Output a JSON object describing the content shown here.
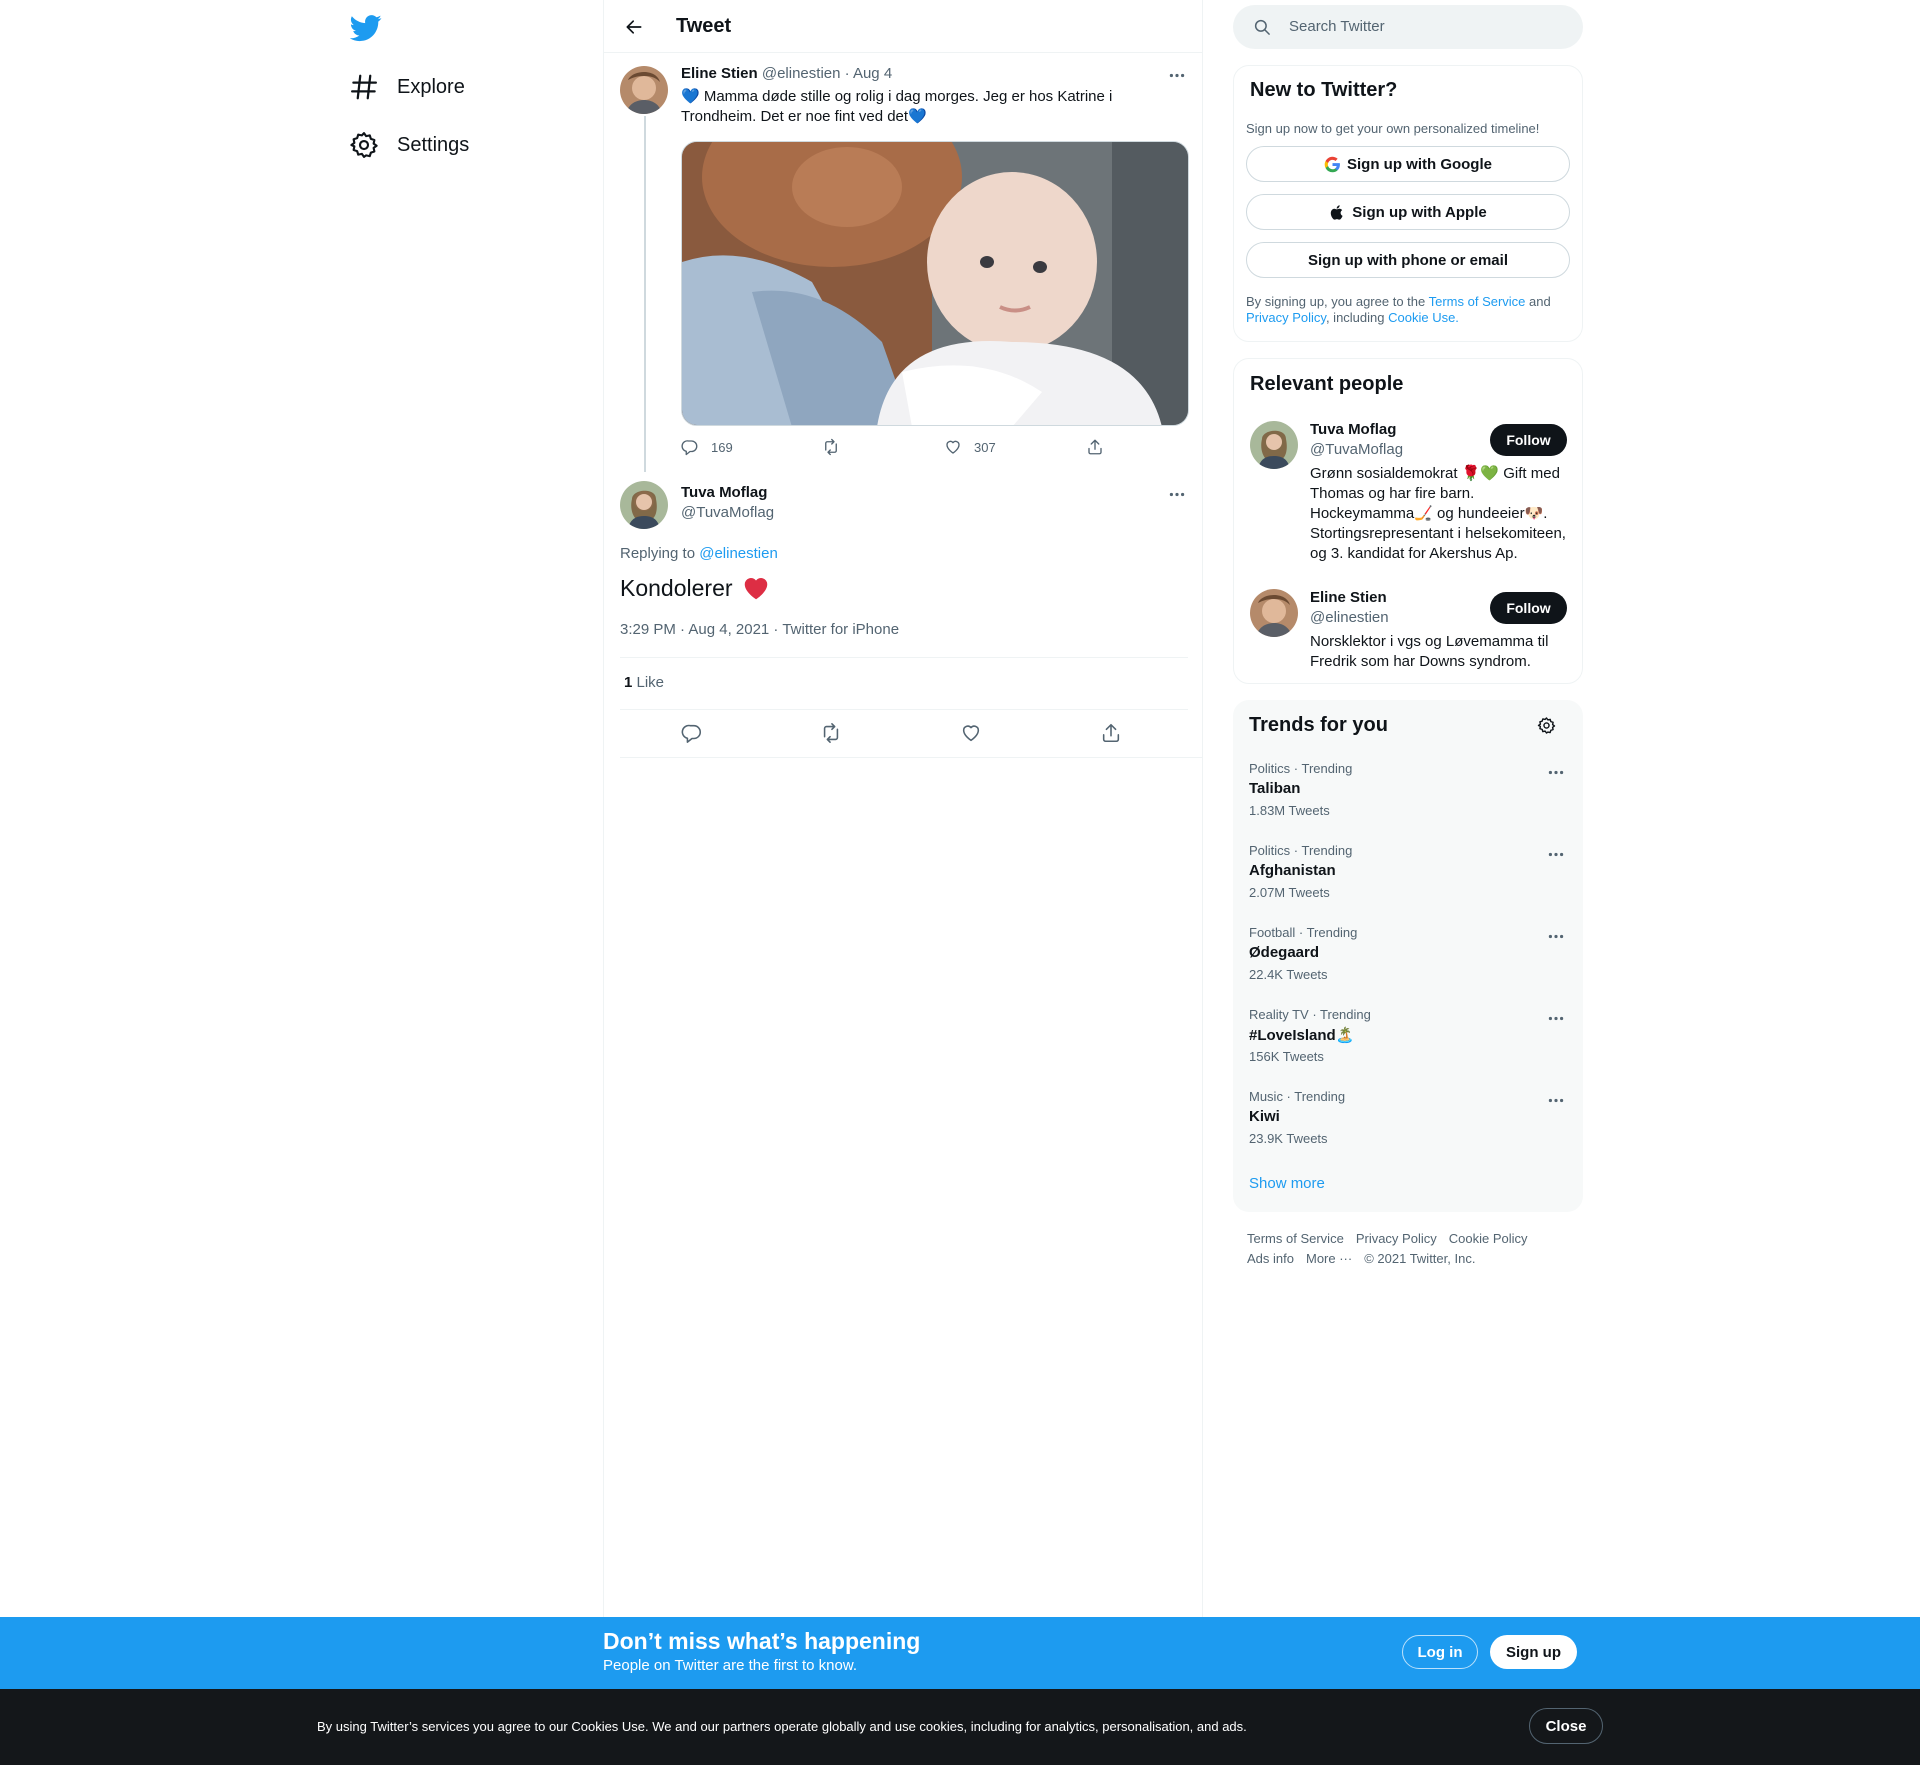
{
  "nav": {
    "logo": "twitter-bird-icon",
    "items": [
      {
        "label": "Explore",
        "icon": "hashtag-icon"
      },
      {
        "label": "Settings",
        "icon": "gear-icon"
      }
    ]
  },
  "header": {
    "title": "Tweet"
  },
  "tweet1": {
    "name": "Eline Stien",
    "meta": " @elinestien · Aug 4",
    "text": "💙 Mamma døde stille og rolig i dag morges. Jeg er hos Katrine i Trondheim. Det er noe fint ved det💙",
    "reply_count": "169",
    "retweet_count": "",
    "like_count": "307"
  },
  "tweet2": {
    "name": "Tuva Moflag",
    "handle": "@TuvaMoflag",
    "replying_prefix": "Replying to ",
    "replying_handle": "@elinestien",
    "text": "Kondolerer",
    "timestamp": "3:29 PM · Aug 4, 2021 · Twitter for iPhone",
    "like_count": "1",
    "like_label": " Like"
  },
  "search": {
    "placeholder": "Search Twitter"
  },
  "signup_card": {
    "title": "New to Twitter?",
    "subtitle": "Sign up now to get your own personalized timeline!",
    "google": "Sign up with Google",
    "apple": "Sign up with Apple",
    "phone": "Sign up with phone or email",
    "legal_1": "By signing up, you agree to the ",
    "terms": "Terms of Service",
    "legal_2": " and ",
    "privacy": "Privacy Policy",
    "legal_3": ", including ",
    "cookie": "Cookie Use."
  },
  "relevant": {
    "title": "Relevant people",
    "people": [
      {
        "name": "Tuva Moflag",
        "handle": "@TuvaMoflag",
        "follow": "Follow",
        "bio": "Grønn sosialdemokrat 🌹💚 Gift med Thomas og har fire barn. Hockeymamma🏒 og hundeeier🐶. Stortingsrepresentant i helsekomiteen, og 3. kandidat for Akershus Ap."
      },
      {
        "name": "Eline Stien",
        "handle": "@elinestien",
        "follow": "Follow",
        "bio": "Norsklektor i vgs og Løvemamma til Fredrik som har Downs syndrom."
      }
    ]
  },
  "trends": {
    "title": "Trends for you",
    "items": [
      {
        "category": "Politics · Trending",
        "name": "Taliban",
        "count": "1.83M Tweets"
      },
      {
        "category": "Politics · Trending",
        "name": "Afghanistan",
        "count": "2.07M Tweets"
      },
      {
        "category": "Football · Trending",
        "name": "Ødegaard",
        "count": "22.4K Tweets"
      },
      {
        "category": "Reality TV · Trending",
        "name": "#LoveIsland🏝️",
        "count": "156K Tweets"
      },
      {
        "category": "Music · Trending",
        "name": "Kiwi",
        "count": "23.9K Tweets"
      }
    ],
    "show_more": "Show more"
  },
  "footer": {
    "links": [
      "Terms of Service",
      "Privacy Policy",
      "Cookie Policy",
      "Ads info",
      "More ···",
      "© 2021 Twitter, Inc."
    ]
  },
  "banner": {
    "title": "Don’t miss what’s happening",
    "subtitle": "People on Twitter are the first to know.",
    "login": "Log in",
    "signup": "Sign up"
  },
  "cookie_bar": {
    "text": "By using Twitter’s services you agree to our Cookies Use. We and our partners operate globally and use cookies, including for analytics, personalisation, and ads.",
    "close": "Close"
  },
  "colors": {
    "accent": "#1d9bf0",
    "text": "#0f1419",
    "muted": "#536471",
    "border": "#eff3f4",
    "dark": "#14171a"
  }
}
